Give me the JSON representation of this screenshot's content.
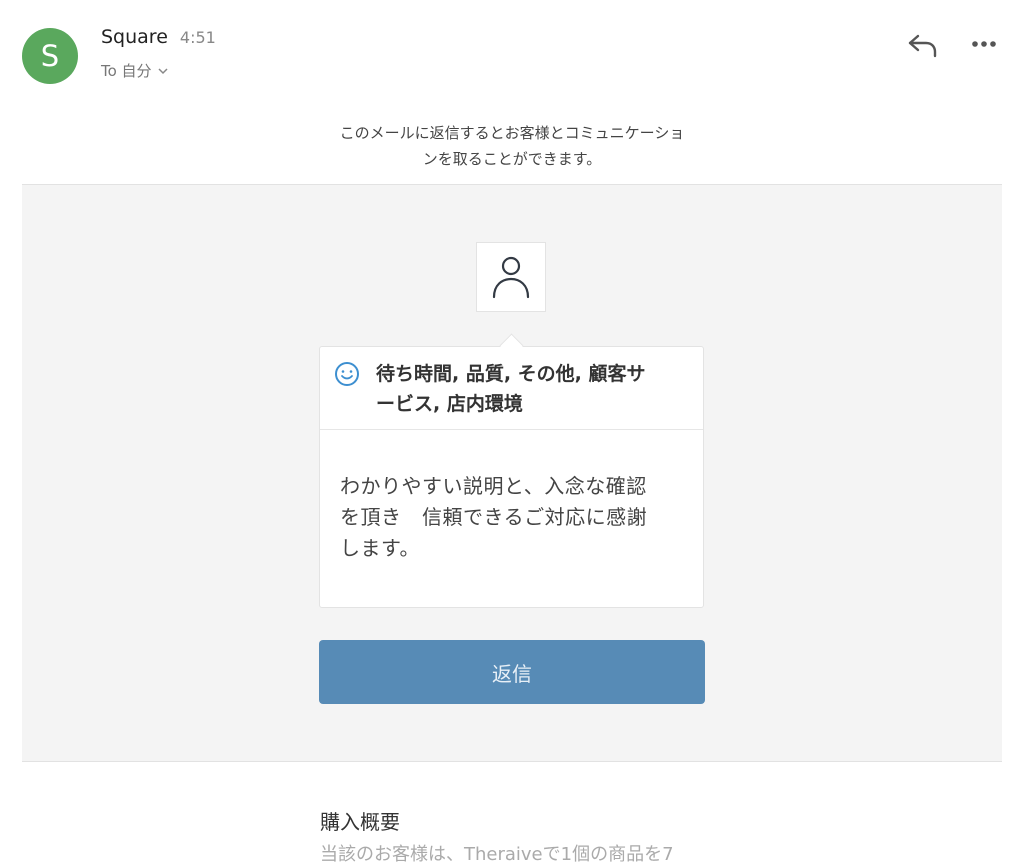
{
  "header": {
    "avatar_letter": "S",
    "sender": "Square",
    "time": "4:51",
    "recipient": "To 自分",
    "avatar_color": "#5aa85d"
  },
  "notice_lines": [
    "このメールに返信するとお客様とコミュニケーショ",
    "ンを取ることができます。"
  ],
  "feedback": {
    "person_icon": "person-outline-icon",
    "sentiment_icon": "smile-icon",
    "categories_line1": "待ち時間, 品質, その他, 顧客サ",
    "categories_line2": "ービス, 店内環境",
    "comment_lines": [
      "わかりやすい説明と、入念な確認",
      "を頂き　信頼できるご対応に感謝",
      "します。"
    ]
  },
  "reply_button": {
    "label": "返信",
    "color": "#578bb6"
  },
  "summary": {
    "title": "購入概要",
    "text": "当該のお客様は、Theraiveで1個の商品を7"
  }
}
